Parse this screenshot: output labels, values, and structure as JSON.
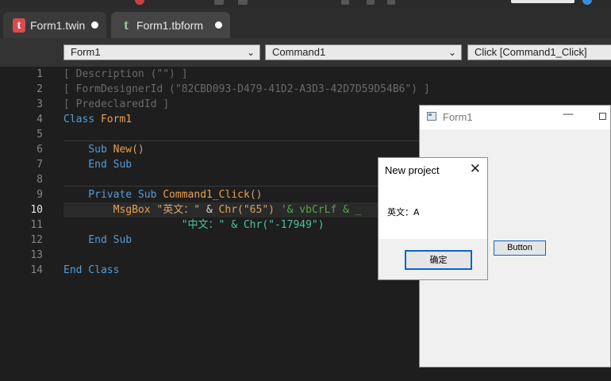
{
  "tabs": [
    {
      "label": "Form1.twin",
      "icon": "twinbasic-file-icon",
      "active": true
    },
    {
      "label": "Form1.tbform",
      "icon": "twinbasic-form-icon",
      "active": false
    }
  ],
  "dropdowns": {
    "object": "Form1",
    "procedure": "Command1",
    "event": "Click [Command1_Click]"
  },
  "editor": {
    "current_line": 10,
    "lines": [
      {
        "n": "1",
        "tokens": [
          {
            "t": "[ Description (\"\") ]",
            "c": "gray"
          }
        ]
      },
      {
        "n": "2",
        "tokens": [
          {
            "t": "[ FormDesignerId (\"82CBD093-D479-41D2-A3D3-42D7D59D54B6\") ]",
            "c": "gray"
          }
        ]
      },
      {
        "n": "3",
        "tokens": [
          {
            "t": "[ PredeclaredId ]",
            "c": "gray"
          }
        ]
      },
      {
        "n": "4",
        "tokens": [
          {
            "t": "Class ",
            "c": "kw"
          },
          {
            "t": "Form1",
            "c": "fn"
          }
        ]
      },
      {
        "n": "5",
        "tokens": []
      },
      {
        "n": "6",
        "tokens": [
          {
            "t": "    Sub ",
            "c": "kw"
          },
          {
            "t": "New",
            "c": "fn"
          },
          {
            "t": "()",
            "c": "str"
          }
        ]
      },
      {
        "n": "7",
        "tokens": [
          {
            "t": "    End Sub",
            "c": "kw"
          }
        ]
      },
      {
        "n": "8",
        "tokens": []
      },
      {
        "n": "9",
        "tokens": [
          {
            "t": "    Private Sub ",
            "c": "kw"
          },
          {
            "t": "Command1_Click",
            "c": "fn"
          },
          {
            "t": "()",
            "c": "str"
          }
        ]
      },
      {
        "n": "10",
        "tokens": [
          {
            "t": "        MsgBox ",
            "c": "fn"
          },
          {
            "t": "\"英文：\" ",
            "c": "str"
          },
          {
            "t": "& ",
            "c": "white"
          },
          {
            "t": "Chr",
            "c": "fn"
          },
          {
            "t": "(\"65\") ",
            "c": "str"
          },
          {
            "t": "'& vbCrLf & _",
            "c": "cm"
          }
        ]
      },
      {
        "n": "11",
        "tokens": [
          {
            "t": "                   \"中文：\" ",
            "c": "strg"
          },
          {
            "t": "& Chr(\"-17949\")",
            "c": "strg"
          }
        ]
      },
      {
        "n": "12",
        "tokens": [
          {
            "t": "    End Sub",
            "c": "kw"
          }
        ]
      },
      {
        "n": "13",
        "tokens": []
      },
      {
        "n": "14",
        "tokens": [
          {
            "t": "End Class",
            "c": "kw"
          }
        ]
      }
    ]
  },
  "form1": {
    "title": "Form1",
    "button_label": "Button"
  },
  "msgbox": {
    "title": "New project",
    "message": "英文：A",
    "ok_label": "确定"
  },
  "colors": {
    "editor_bg": "#1e1e1e",
    "keyword": "#569cd6",
    "identifier": "#e6a052",
    "string": "#d7a36a",
    "comment": "#57a64a",
    "focus_blue": "#0a63c9"
  }
}
